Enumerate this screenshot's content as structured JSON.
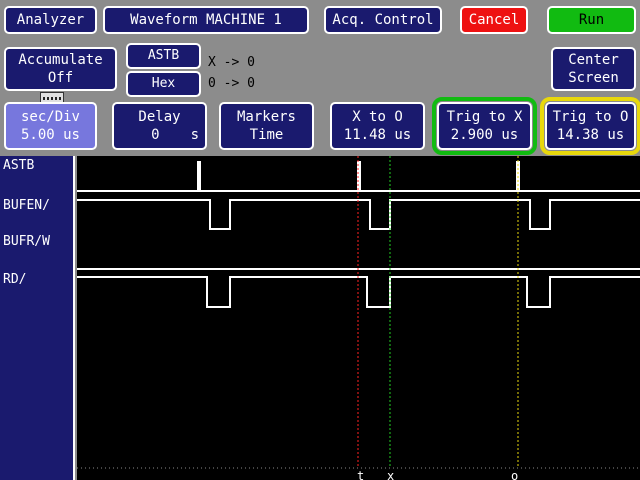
{
  "toolbar": {
    "analyzer": "Analyzer",
    "waveform": "Waveform MACHINE 1",
    "acq_control": "Acq. Control",
    "cancel": "Cancel",
    "run": "Run"
  },
  "row2": {
    "accumulate_line1": "Accumulate",
    "accumulate_line2": "Off",
    "astb": "ASTB",
    "hex": "Hex",
    "x_map": "X -> 0",
    "o_map": "0 -> 0",
    "center_line1": "Center",
    "center_line2": "Screen"
  },
  "row3": {
    "secdiv_label": "sec/Div",
    "secdiv_value": "5.00 us",
    "delay_label": "Delay",
    "delay_value": "0",
    "delay_unit": "s",
    "markers_label": "Markers",
    "markers_value": "Time",
    "x_to_o_label": "X to O",
    "x_to_o_value": "11.48 us",
    "trig_to_x_label": "Trig to X",
    "trig_to_x_value": "2.900 us",
    "trig_to_o_label": "Trig to O",
    "trig_to_o_value": "14.38 us"
  },
  "signals": {
    "astb": "ASTB",
    "bufen": "BUFEN/",
    "bufrw": "BUFR/W",
    "rd": "RD/"
  },
  "markers": {
    "t": "t",
    "x": "x",
    "o": "o"
  },
  "colors": {
    "button_bg": "#1a1a6e",
    "cancel": "#ee1111",
    "run": "#11bb11",
    "trig_x_ring": "#11bb11",
    "trig_o_ring": "#e8d80c",
    "trigger_marker": "#ff2222",
    "x_marker": "#22cc22",
    "o_marker": "#e8d80c",
    "background": "#8c8c8c"
  }
}
